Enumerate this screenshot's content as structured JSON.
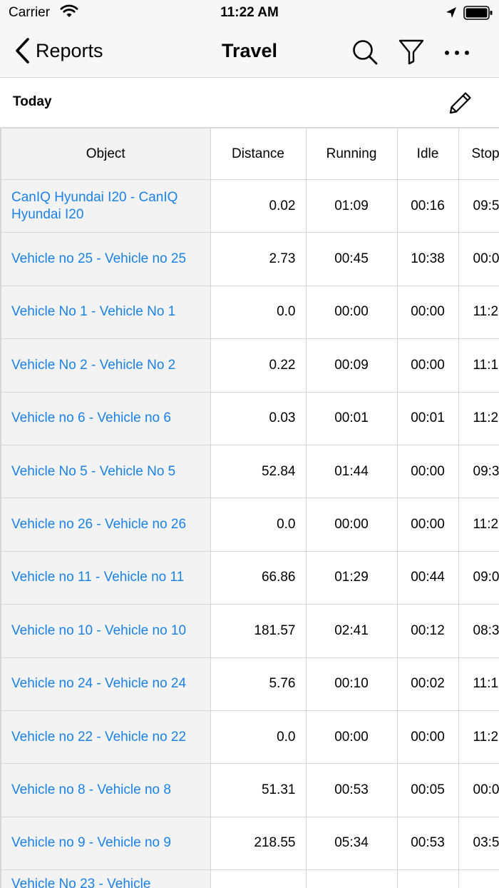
{
  "status_bar": {
    "carrier": "Carrier",
    "time": "11:22 AM"
  },
  "nav": {
    "back_label": "Reports",
    "title": "Travel"
  },
  "period": {
    "label": "Today"
  },
  "columns": [
    "Object",
    "Distance",
    "Running",
    "Idle",
    "Stop"
  ],
  "rows": [
    {
      "object": "CanIQ Hyundai I20 - CanIQ Hyundai I20",
      "distance": "0.02",
      "running": "01:09",
      "idle": "00:16",
      "stop": "09:5"
    },
    {
      "object": "Vehicle no 25 - Vehicle no 25",
      "distance": "2.73",
      "running": "00:45",
      "idle": "10:38",
      "stop": "00:0"
    },
    {
      "object": "Vehicle No 1 - Vehicle No 1",
      "distance": "0.0",
      "running": "00:00",
      "idle": "00:00",
      "stop": "11:2"
    },
    {
      "object": "Vehicle No 2 - Vehicle No 2",
      "distance": "0.22",
      "running": "00:09",
      "idle": "00:00",
      "stop": "11:1"
    },
    {
      "object": "Vehicle no 6 - Vehicle no 6",
      "distance": "0.03",
      "running": "00:01",
      "idle": "00:01",
      "stop": "11:2"
    },
    {
      "object": "Vehicle No 5 - Vehicle No 5",
      "distance": "52.84",
      "running": "01:44",
      "idle": "00:00",
      "stop": "09:3"
    },
    {
      "object": "Vehicle no 26 - Vehicle no 26",
      "distance": "0.0",
      "running": "00:00",
      "idle": "00:00",
      "stop": "11:2"
    },
    {
      "object": "Vehicle no 11 - Vehicle no 11",
      "distance": "66.86",
      "running": "01:29",
      "idle": "00:44",
      "stop": "09:0"
    },
    {
      "object": "Vehicle no 10 - Vehicle no 10",
      "distance": "181.57",
      "running": "02:41",
      "idle": "00:12",
      "stop": "08:3"
    },
    {
      "object": "Vehicle no 24 - Vehicle no 24",
      "distance": "5.76",
      "running": "00:10",
      "idle": "00:02",
      "stop": "11:1"
    },
    {
      "object": "Vehicle no 22 - Vehicle no 22",
      "distance": "0.0",
      "running": "00:00",
      "idle": "00:00",
      "stop": "11:2"
    },
    {
      "object": "Vehicle no 8 - Vehicle no 8",
      "distance": "51.31",
      "running": "00:53",
      "idle": "00:05",
      "stop": "00:0"
    },
    {
      "object": "Vehicle no 9 - Vehicle no 9",
      "distance": "218.55",
      "running": "05:34",
      "idle": "00:53",
      "stop": "03:5"
    },
    {
      "object": "Vehicle No 23 - Vehicle",
      "distance": "",
      "running": "",
      "idle": "",
      "stop": ""
    }
  ],
  "colors": {
    "link": "#1a82e6",
    "bar": "#f7f7f7",
    "object_cell": "#f3f3f3",
    "grid": "#d6d6d6"
  },
  "icons": [
    "wifi-icon",
    "location-arrow-icon",
    "battery-icon",
    "chevron-left-icon",
    "search-icon",
    "filter-icon",
    "more-icon",
    "pencil-icon"
  ]
}
